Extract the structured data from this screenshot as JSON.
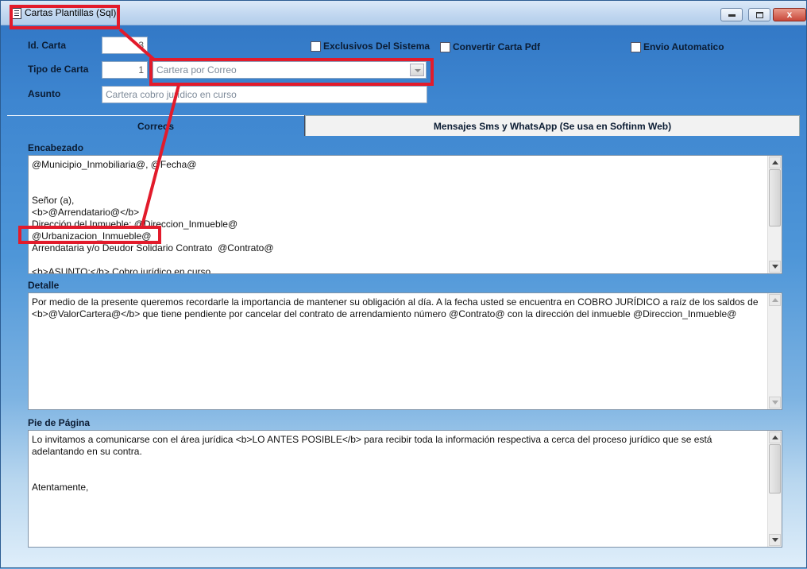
{
  "window": {
    "title": "Cartas Plantillas (Sql)",
    "close_glyph": "x"
  },
  "form": {
    "id_label": "Id. Carta",
    "id_value": "3",
    "tipo_label": "Tipo de Carta",
    "tipo_value": "1",
    "tipo_select": "Cartera por Correo",
    "asunto_label": "Asunto",
    "asunto_value": "Cartera cobro jurídico en curso",
    "chk_exclusivos": "Exclusivos Del Sistema",
    "chk_pdf": "Convertir Carta Pdf",
    "chk_envio": "Envio Automatico"
  },
  "tabs": {
    "correos": "Correos",
    "sms": "Mensajes Sms y WhatsApp (Se usa en Softinm Web)"
  },
  "encabezado": {
    "label": "Encabezado",
    "text": "@Municipio_Inmobiliaria@, @Fecha@\n\n\nSeñor (a),\n<b>@Arrendatario@</b>\nDirección del Inmueble: @Direccion_Inmueble@\n@Urbanizacion_Inmueble@\nArrendataria y/o Deudor Solidario Contrato  @Contrato@\n\n<b>ASUNTO:</b> Cobro jurídico en curso"
  },
  "detalle": {
    "label": "Detalle",
    "text": "Por medio de la presente queremos recordarle la importancia de mantener su obligación al día. A la fecha usted se encuentra en COBRO JURÍDICO a raíz de los saldos de  <b>@ValorCartera@</b> que tiene pendiente por cancelar del contrato de arrendamiento número @Contrato@ con la dirección del inmueble @Direccion_Inmueble@"
  },
  "pie": {
    "label": "Pie de Página",
    "text": "Lo invitamos a comunicarse con el área jurídica <b>LO ANTES POSIBLE</b> para recibir toda la información respectiva a cerca del proceso jurídico que se está adelantando en su contra.\n\n\nAtentamente,\n\n\n\n\n\nAbogado"
  },
  "colors": {
    "highlight": "#e21b2b"
  }
}
